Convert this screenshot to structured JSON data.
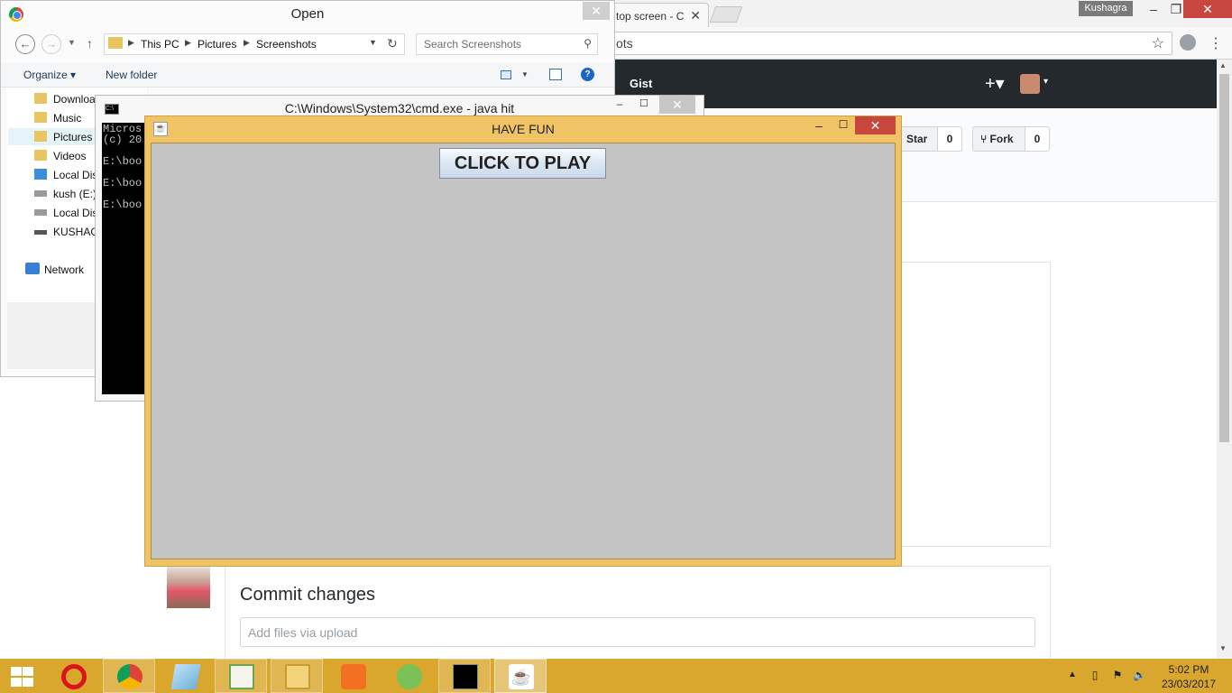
{
  "chrome": {
    "tab_title": "top screen - C",
    "tab_close": "✕",
    "user_badge": "Kushagra",
    "omnibox_text": "ots",
    "window_controls": {
      "minimize": "–",
      "maximize": "❐",
      "close": "✕"
    }
  },
  "github": {
    "nav_gist": "Gist",
    "plus": "+▾",
    "avatar_caret": "▾",
    "star_label": "Star",
    "star_count": "0",
    "fork_label": "Fork",
    "fork_count": "0",
    "commit_title": "Commit changes",
    "commit_placeholder": "Add files via upload"
  },
  "open_dialog": {
    "title": "Open",
    "close": "✕",
    "breadcrumb": [
      "This PC",
      "Pictures",
      "Screenshots"
    ],
    "search_placeholder": "Search Screenshots",
    "organize": "Organize ▾",
    "new_folder": "New folder",
    "help": "?",
    "nav_items": [
      {
        "label": "Downloa",
        "icon": "folder-icon"
      },
      {
        "label": "Music",
        "icon": "music-folder-icon"
      },
      {
        "label": "Pictures",
        "icon": "pictures-folder-icon"
      },
      {
        "label": "Videos",
        "icon": "videos-folder-icon"
      },
      {
        "label": "Local Dis",
        "icon": "windows-drive-icon"
      },
      {
        "label": "kush (E:)",
        "icon": "drive-icon"
      },
      {
        "label": "Local Dis",
        "icon": "drive-icon"
      },
      {
        "label": "KUSHAG",
        "icon": "usb-drive-icon"
      }
    ],
    "network": "Network"
  },
  "cmd": {
    "title": "C:\\Windows\\System32\\cmd.exe - java  hit",
    "lines": [
      "Micros",
      "(c) 20",
      "E:\\boo",
      "E:\\boo",
      "E:\\boo"
    ],
    "close": "✕"
  },
  "java": {
    "title": "HAVE FUN",
    "play_button": "CLICK TO PLAY",
    "close": "✕"
  },
  "taskbar": {
    "apps": [
      {
        "name": "opera-icon",
        "state": "pinned"
      },
      {
        "name": "chrome-icon",
        "state": "running"
      },
      {
        "name": "notepad-icon",
        "state": "pinned"
      },
      {
        "name": "notepad-plus-plus-icon",
        "state": "running"
      },
      {
        "name": "file-explorer-icon",
        "state": "running"
      },
      {
        "name": "foxit-pdf-icon",
        "state": "pinned"
      },
      {
        "name": "android-studio-icon",
        "state": "pinned"
      },
      {
        "name": "cmd-icon",
        "state": "running"
      },
      {
        "name": "java-icon",
        "state": "active"
      }
    ],
    "time": "5:02 PM",
    "date": "23/03/2017"
  },
  "colors": {
    "taskbar": "#d9a72e",
    "java_frame": "#f0c464",
    "close_red": "#c7473e",
    "github_header": "#24292e"
  }
}
